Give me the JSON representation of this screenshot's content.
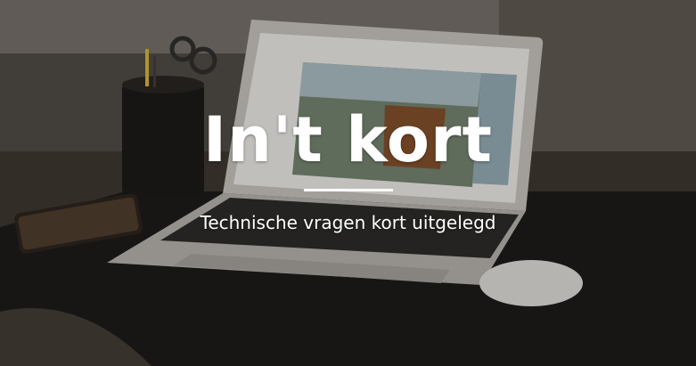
{
  "hero": {
    "title": "In't kort",
    "subtitle": "Technische vragen kort uitgelegd"
  },
  "colors": {
    "text": "#ffffff",
    "overlay": "#000000"
  }
}
